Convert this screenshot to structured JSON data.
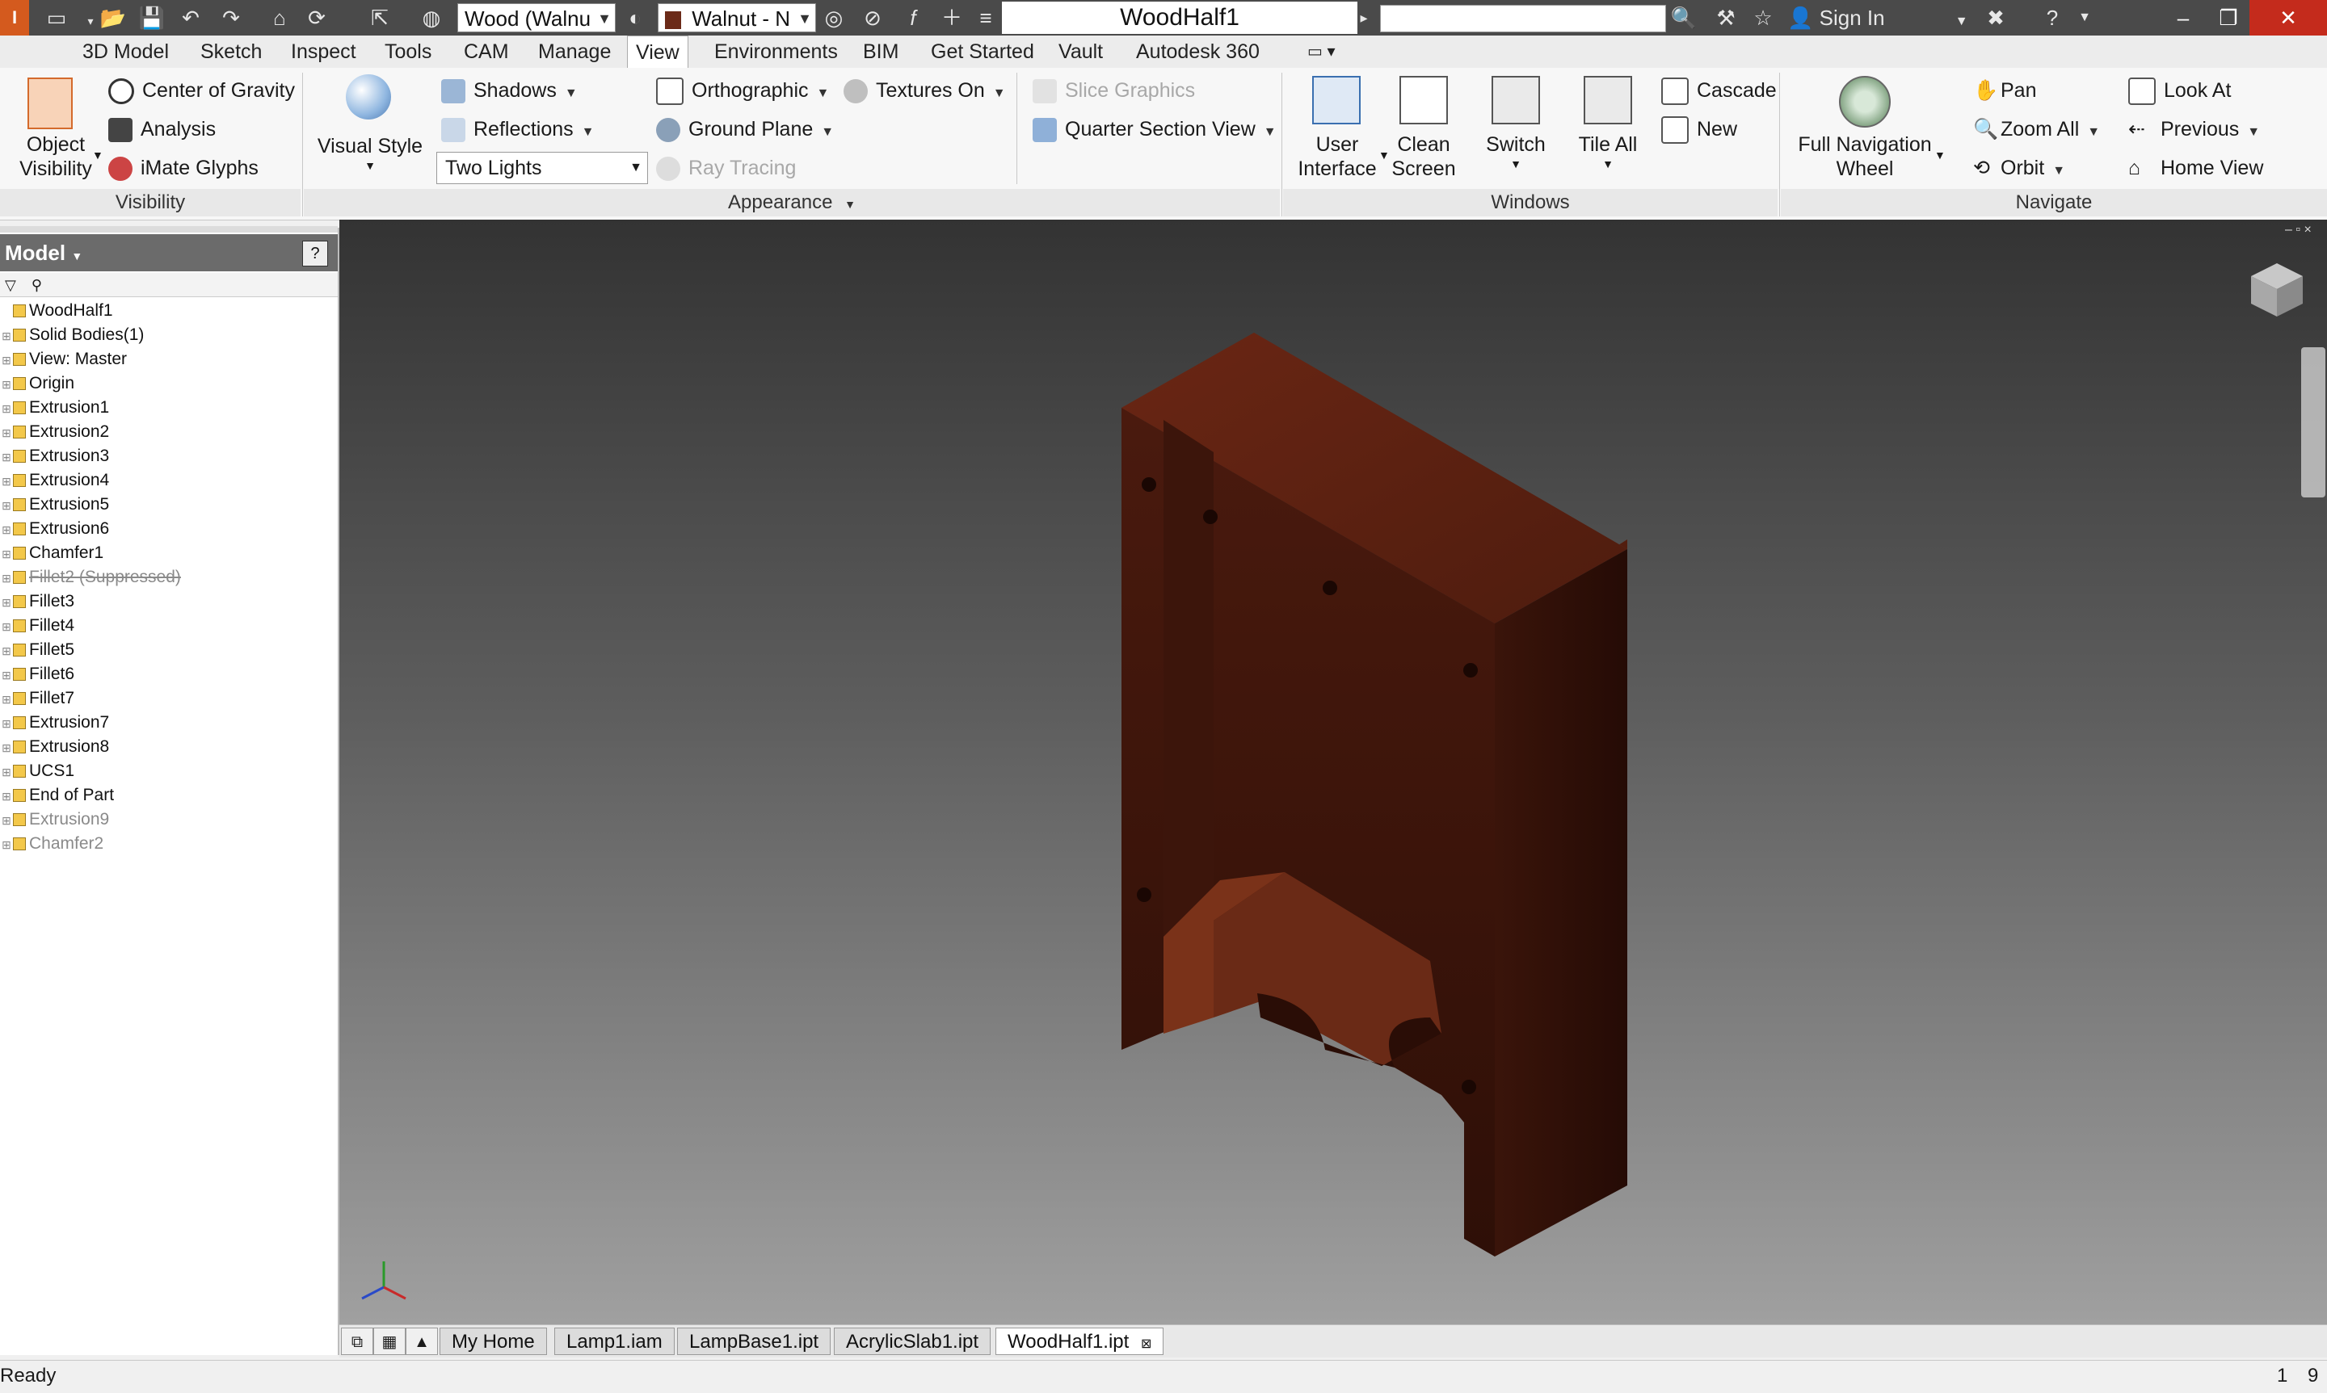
{
  "app": {
    "logo_letter": "I",
    "document_title": "WoodHalf1"
  },
  "quick_access": {
    "material_combo": "Wood (Walnu",
    "appearance_combo": "Walnut - N",
    "sign_in_label": "Sign In"
  },
  "window_controls": {
    "minimize": "–",
    "restore": "❐",
    "close": "✕"
  },
  "ribbon_tabs": [
    "3D Model",
    "Sketch",
    "Inspect",
    "Tools",
    "CAM",
    "Manage",
    "View",
    "Environments",
    "BIM",
    "Get Started",
    "Vault",
    "Autodesk 360"
  ],
  "active_tab": "View",
  "visibility": {
    "object_visibility": [
      "Object",
      "Visibility"
    ],
    "center_of_gravity": "Center of Gravity",
    "analysis": "Analysis",
    "imate_glyphs": "iMate Glyphs",
    "title": "Visibility"
  },
  "appearance": {
    "visual_style": "Visual Style",
    "shadows": "Shadows",
    "reflections": "Reflections",
    "lighting_select": "Two Lights",
    "orthographic": "Orthographic",
    "ground_plane": "Ground Plane",
    "ray_tracing": "Ray Tracing",
    "textures_on": "Textures On",
    "slice_graphics": "Slice Graphics",
    "quarter_section_view": "Quarter Section View",
    "title": "Appearance"
  },
  "windows": {
    "user_interface": [
      "User",
      "Interface"
    ],
    "clean_screen": [
      "Clean",
      "Screen"
    ],
    "switch": "Switch",
    "tile_all": "Tile All",
    "cascade": "Cascade",
    "new": "New",
    "title": "Windows"
  },
  "navigate": {
    "full_navigation_wheel": [
      "Full Navigation",
      "Wheel"
    ],
    "pan": "Pan",
    "zoom_all": "Zoom All",
    "orbit": "Orbit",
    "look_at": "Look At",
    "previous": "Previous",
    "home_view": "Home View",
    "title": "Navigate"
  },
  "browser": {
    "title": "Model",
    "help": "?",
    "tree": [
      {
        "label": "WoodHalf1",
        "indent": 0,
        "style": "normal"
      },
      {
        "label": "Solid Bodies(1)",
        "indent": 1,
        "style": "normal"
      },
      {
        "label": "View: Master",
        "indent": 1,
        "style": "normal"
      },
      {
        "label": "Origin",
        "indent": 1,
        "style": "normal"
      },
      {
        "label": "Extrusion1",
        "indent": 1,
        "style": "normal"
      },
      {
        "label": "Extrusion2",
        "indent": 1,
        "style": "normal"
      },
      {
        "label": "Extrusion3",
        "indent": 1,
        "style": "normal"
      },
      {
        "label": "Extrusion4",
        "indent": 1,
        "style": "normal"
      },
      {
        "label": "Extrusion5",
        "indent": 1,
        "style": "normal"
      },
      {
        "label": "Extrusion6",
        "indent": 1,
        "style": "normal"
      },
      {
        "label": "Chamfer1",
        "indent": 1,
        "style": "normal"
      },
      {
        "label": "Fillet2 (Suppressed)",
        "indent": 1,
        "style": "suppressed"
      },
      {
        "label": "Fillet3",
        "indent": 1,
        "style": "normal"
      },
      {
        "label": "Fillet4",
        "indent": 1,
        "style": "normal"
      },
      {
        "label": "Fillet5",
        "indent": 1,
        "style": "normal"
      },
      {
        "label": "Fillet6",
        "indent": 1,
        "style": "normal"
      },
      {
        "label": "Fillet7",
        "indent": 1,
        "style": "normal"
      },
      {
        "label": "Extrusion7",
        "indent": 1,
        "style": "normal"
      },
      {
        "label": "Extrusion8",
        "indent": 1,
        "style": "normal"
      },
      {
        "label": "UCS1",
        "indent": 1,
        "style": "normal"
      },
      {
        "label": "End of Part",
        "indent": 1,
        "style": "normal"
      },
      {
        "label": "Extrusion9",
        "indent": 1,
        "style": "grey"
      },
      {
        "label": "Chamfer2",
        "indent": 1,
        "style": "grey"
      }
    ]
  },
  "doc_tabs": [
    "My Home",
    "Lamp1.iam",
    "LampBase1.ipt",
    "AcrylicSlab1.ipt",
    "WoodHalf1.ipt"
  ],
  "active_doc_tab": "WoodHalf1.ipt",
  "status": {
    "text": "Ready",
    "count_left": "1",
    "count_right": "9"
  },
  "colors": {
    "wood_top": "#5a2012",
    "wood_front": "#4a1a0e",
    "wood_side": "#3a140a",
    "accent": "#3a6fb0"
  }
}
